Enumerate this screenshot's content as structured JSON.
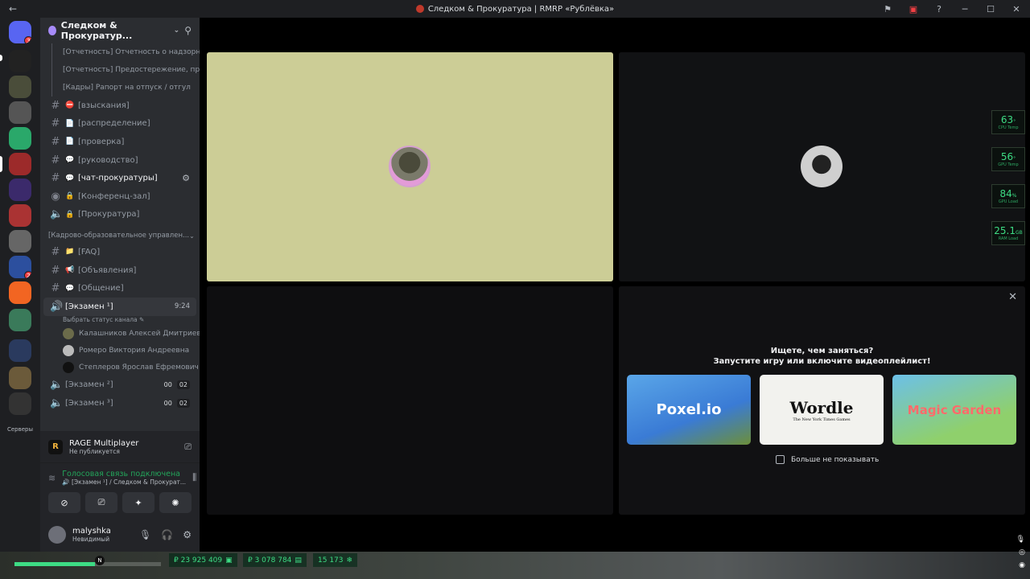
{
  "titlebar": {
    "back": "←",
    "title": "Следком & Прокуратура | RMRP «Рублёвка»",
    "icons": [
      "flag-icon",
      "error-monitor-icon",
      "help-icon"
    ],
    "minimize": "─",
    "maximize": "☐",
    "close": "✕"
  },
  "guilds": {
    "servers_label": "Серверы",
    "badges": [
      "3",
      "2"
    ]
  },
  "server": {
    "name": "Следком & Прокуратур...",
    "threads": [
      "[Отчетность] Отчетность о надзорны...",
      "[Отчетность] Предостережение, пре...",
      "[Кадры] Рапорт на отпуск / отгул"
    ],
    "channels": [
      {
        "emoji": "⛔",
        "name": "[взыскания]"
      },
      {
        "emoji": "📄",
        "name": "[распределение]"
      },
      {
        "emoji": "📄",
        "name": "[проверка]"
      },
      {
        "emoji": "💬",
        "name": "[руководство]"
      },
      {
        "emoji": "💬",
        "name": "[чат-прокуратуры]"
      },
      {
        "emoji": "🔒",
        "name": "[Конференц-зал]"
      },
      {
        "emoji": "🔒",
        "name": "[Прокуратура]"
      }
    ],
    "category2": "[Кадрово-образовательное управлен...",
    "channels2": [
      {
        "emoji": "📁",
        "name": "[FAQ]"
      },
      {
        "emoji": "📢",
        "name": "[Объявления]"
      },
      {
        "emoji": "💬",
        "name": "[Общение]"
      }
    ],
    "voice": {
      "name": "[Экзамен ¹]",
      "time": "9:24",
      "status": "Выбрать статус канала ✎",
      "users": [
        "Калашников Алексей Дмитриев...",
        "Ромеро Виктория Андреевна",
        "Степлеров Ярослав Ефремович"
      ]
    },
    "voice2": [
      {
        "name": "[Экзамен ²]",
        "c1": "00",
        "c2": "02"
      },
      {
        "name": "[Экзамен ³]",
        "c1": "00",
        "c2": "02"
      }
    ]
  },
  "panel": {
    "activity_logo": "R",
    "activity_name": "RAGE Multiplayer",
    "activity_sub": "Не публикуется",
    "voice_title": "Голосовая связь подключена",
    "voice_sub": "🔊 [Экзамен ¹] / Следком & Прокурат...",
    "user_name": "malyshka",
    "user_status": "Невидимый"
  },
  "promo": {
    "question": "Ищете, чем заняться?",
    "question2": "Запустите игру или включите видеоплейлист!",
    "games": [
      "Poxel.io",
      "Wordle",
      "Magic Garden"
    ],
    "wordle_sub": "The New York Times Games",
    "no_show": "Больше не показывать"
  },
  "overlay": [
    {
      "value": "63",
      "unit": "°",
      "label": "CPU Temp"
    },
    {
      "value": "56",
      "unit": "°",
      "label": "GPU Temp"
    },
    {
      "value": "84",
      "unit": "%",
      "label": "GPU Load"
    },
    {
      "value": "25.1",
      "unit": "GB",
      "label": "RAM Load"
    }
  ],
  "hud": {
    "compass": "N",
    "cash": "₽ 23 925 409",
    "bank": "₽ 3 078 784",
    "points": "15 173",
    "health_fraction": 0.55
  },
  "colors": {
    "accent": "#3ddc84",
    "voice_green": "#23a55a",
    "tile1_bg": "#cccd96"
  }
}
